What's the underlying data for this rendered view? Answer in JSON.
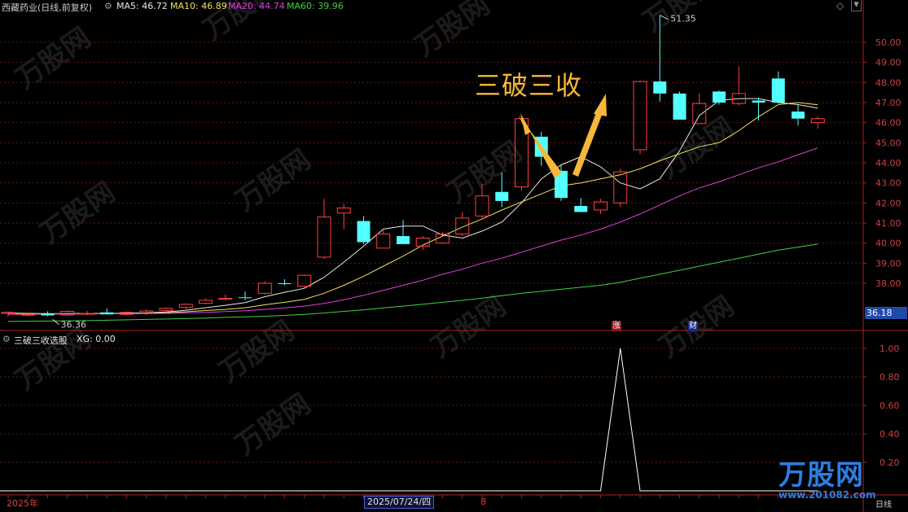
{
  "stock_title": "西藏药业(日线,前复权)",
  "indicators": [
    {
      "label": "MA5: 46.72",
      "color": "#e8e8e8"
    },
    {
      "label": "MA10: 46.89",
      "color": "#f0e060"
    },
    {
      "label": "MA20: 44.74",
      "color": "#e040e0"
    },
    {
      "label": "MA60: 39.96",
      "color": "#40d040"
    }
  ],
  "overlay_text": "三破三收",
  "price_tag": "36.18",
  "high_label": "51.35",
  "low_label": "36.36",
  "events": [
    "涨",
    "财"
  ],
  "sub_title": "三破三收选股",
  "sub_value": "XG: 0.00",
  "year_label": "2025年",
  "date_label": "2025/07/24/四",
  "month_label": "8",
  "period_label": "日线",
  "watermark_text": "万股网",
  "watermark_url": "www.201082.com",
  "chart_data": [
    {
      "type": "candlestick",
      "ylim": [
        36.0,
        51.0
      ],
      "y_ticks": [
        "50.00",
        "49.00",
        "48.00",
        "47.00",
        "46.00",
        "45.00",
        "44.00",
        "43.00",
        "42.00",
        "41.00",
        "40.00",
        "39.00",
        "38.00"
      ],
      "candles": [
        {
          "o": 36.5,
          "h": 36.6,
          "l": 36.35,
          "c": 36.55,
          "up": true
        },
        {
          "o": 36.45,
          "h": 36.55,
          "l": 36.36,
          "c": 36.45,
          "up": true
        },
        {
          "o": 36.48,
          "h": 36.6,
          "l": 36.36,
          "c": 36.4,
          "up": false
        },
        {
          "o": 36.42,
          "h": 36.65,
          "l": 36.38,
          "c": 36.6,
          "up": true
        },
        {
          "o": 36.5,
          "h": 36.62,
          "l": 36.42,
          "c": 36.5,
          "up": true
        },
        {
          "o": 36.55,
          "h": 36.75,
          "l": 36.45,
          "c": 36.45,
          "up": false
        },
        {
          "o": 36.45,
          "h": 36.6,
          "l": 36.4,
          "c": 36.55,
          "up": true
        },
        {
          "o": 36.5,
          "h": 36.7,
          "l": 36.42,
          "c": 36.62,
          "up": true
        },
        {
          "o": 36.65,
          "h": 36.8,
          "l": 36.55,
          "c": 36.75,
          "up": true
        },
        {
          "o": 36.8,
          "h": 37.0,
          "l": 36.7,
          "c": 36.95,
          "up": true
        },
        {
          "o": 37.0,
          "h": 37.25,
          "l": 36.95,
          "c": 37.15,
          "up": true
        },
        {
          "o": 37.25,
          "h": 37.45,
          "l": 37.15,
          "c": 37.2,
          "up": true
        },
        {
          "o": 37.3,
          "h": 37.6,
          "l": 37.15,
          "c": 37.3,
          "up": false
        },
        {
          "o": 37.5,
          "h": 38.1,
          "l": 37.45,
          "c": 38.0,
          "up": true
        },
        {
          "o": 38.0,
          "h": 38.2,
          "l": 37.9,
          "c": 38.0,
          "up": false
        },
        {
          "o": 37.85,
          "h": 38.45,
          "l": 37.75,
          "c": 38.4,
          "up": true
        },
        {
          "o": 39.3,
          "h": 42.2,
          "l": 39.2,
          "c": 41.3,
          "up": true
        },
        {
          "o": 41.5,
          "h": 41.95,
          "l": 40.7,
          "c": 41.75,
          "up": true
        },
        {
          "o": 41.1,
          "h": 41.35,
          "l": 39.95,
          "c": 40.05,
          "up": false
        },
        {
          "o": 39.75,
          "h": 40.65,
          "l": 39.75,
          "c": 40.45,
          "up": true
        },
        {
          "o": 40.35,
          "h": 41.15,
          "l": 39.95,
          "c": 39.95,
          "up": false
        },
        {
          "o": 39.85,
          "h": 40.35,
          "l": 39.65,
          "c": 40.25,
          "up": true
        },
        {
          "o": 40.0,
          "h": 40.55,
          "l": 39.95,
          "c": 40.45,
          "up": true
        },
        {
          "o": 40.45,
          "h": 41.55,
          "l": 40.35,
          "c": 41.25,
          "up": true
        },
        {
          "o": 41.35,
          "h": 42.95,
          "l": 41.25,
          "c": 42.35,
          "up": true
        },
        {
          "o": 42.55,
          "h": 43.55,
          "l": 41.8,
          "c": 42.1,
          "up": false
        },
        {
          "o": 42.8,
          "h": 46.25,
          "l": 42.6,
          "c": 46.2,
          "up": true
        },
        {
          "o": 45.3,
          "h": 45.55,
          "l": 43.85,
          "c": 44.3,
          "up": false
        },
        {
          "o": 43.6,
          "h": 43.9,
          "l": 42.1,
          "c": 42.25,
          "up": false
        },
        {
          "o": 41.85,
          "h": 42.25,
          "l": 41.55,
          "c": 41.55,
          "up": false
        },
        {
          "o": 41.65,
          "h": 42.2,
          "l": 41.45,
          "c": 42.05,
          "up": true
        },
        {
          "o": 42.0,
          "h": 43.7,
          "l": 41.8,
          "c": 43.55,
          "up": true
        },
        {
          "o": 44.65,
          "h": 48.1,
          "l": 44.45,
          "c": 48.05,
          "up": true
        },
        {
          "o": 48.05,
          "h": 51.35,
          "l": 47.05,
          "c": 47.45,
          "up": false
        },
        {
          "o": 47.45,
          "h": 47.55,
          "l": 46.15,
          "c": 46.15,
          "up": false
        },
        {
          "o": 45.95,
          "h": 47.45,
          "l": 45.95,
          "c": 46.95,
          "up": true
        },
        {
          "o": 47.0,
          "h": 47.6,
          "l": 46.9,
          "c": 47.55,
          "up": false
        },
        {
          "o": 46.95,
          "h": 48.8,
          "l": 46.85,
          "c": 47.45,
          "up": true
        },
        {
          "o": 47.0,
          "h": 47.25,
          "l": 46.1,
          "c": 47.1,
          "up": false
        },
        {
          "o": 48.2,
          "h": 48.55,
          "l": 46.95,
          "c": 47.0,
          "up": false
        },
        {
          "o": 46.55,
          "h": 46.9,
          "l": 45.85,
          "c": 46.2,
          "up": false
        },
        {
          "o": 46.0,
          "h": 46.3,
          "l": 45.7,
          "c": 46.2,
          "up": true
        }
      ],
      "ma": [
        {
          "name": "MA5",
          "color": "#e8e8e8",
          "values": [
            36.52,
            36.5,
            36.47,
            36.49,
            36.5,
            36.5,
            36.51,
            36.53,
            36.57,
            36.66,
            36.78,
            36.9,
            37.04,
            37.33,
            37.55,
            37.75,
            38.3,
            39.05,
            39.85,
            40.7,
            40.85,
            40.85,
            40.4,
            40.25,
            40.6,
            41.05,
            42.0,
            43.2,
            43.9,
            44.3,
            43.8,
            43.0,
            42.7,
            43.2,
            44.6,
            46.35,
            47.1,
            47.2,
            47.2,
            47.0,
            46.9,
            46.72
          ]
        },
        {
          "name": "MA10",
          "color": "#f0e060",
          "values": [
            36.5,
            36.5,
            36.49,
            36.49,
            36.5,
            36.5,
            36.5,
            36.51,
            36.53,
            36.58,
            36.64,
            36.7,
            36.78,
            36.93,
            37.05,
            37.2,
            37.5,
            37.9,
            38.35,
            38.85,
            39.35,
            39.9,
            40.35,
            40.8,
            41.2,
            41.65,
            42.05,
            42.45,
            42.85,
            43.0,
            43.2,
            43.4,
            43.7,
            44.1,
            44.45,
            44.8,
            45.0,
            45.6,
            46.3,
            46.9,
            47.0,
            46.89
          ]
        },
        {
          "name": "MA20",
          "color": "#e040e0",
          "values": [
            36.45,
            36.46,
            36.46,
            36.47,
            36.47,
            36.48,
            36.48,
            36.49,
            36.5,
            36.52,
            36.55,
            36.59,
            36.63,
            36.7,
            36.77,
            36.86,
            37.0,
            37.18,
            37.4,
            37.65,
            37.9,
            38.15,
            38.45,
            38.7,
            39.0,
            39.25,
            39.55,
            39.85,
            40.15,
            40.4,
            40.7,
            41.05,
            41.45,
            41.9,
            42.35,
            42.75,
            43.05,
            43.4,
            43.75,
            44.05,
            44.4,
            44.74
          ]
        },
        {
          "name": "MA60",
          "color": "#40d040",
          "values": [
            36.1,
            36.11,
            36.12,
            36.13,
            36.14,
            36.16,
            36.18,
            36.2,
            36.22,
            36.24,
            36.27,
            36.3,
            36.33,
            36.36,
            36.4,
            36.45,
            36.52,
            36.6,
            36.68,
            36.77,
            36.86,
            36.96,
            37.05,
            37.15,
            37.26,
            37.38,
            37.5,
            37.6,
            37.7,
            37.8,
            37.9,
            38.05,
            38.25,
            38.45,
            38.65,
            38.85,
            39.05,
            39.25,
            39.45,
            39.65,
            39.8,
            39.96
          ]
        }
      ]
    },
    {
      "type": "line",
      "name": "XG",
      "ylim": [
        0,
        1.1
      ],
      "y_ticks": [
        "1.00",
        "0.80",
        "0.60",
        "0.40",
        "0.20"
      ],
      "values": [
        0,
        0,
        0,
        0,
        0,
        0,
        0,
        0,
        0,
        0,
        0,
        0,
        0,
        0,
        0,
        0,
        0,
        0,
        0,
        0,
        0,
        0,
        0,
        0,
        0,
        0,
        0,
        0,
        0,
        0,
        0,
        1,
        0,
        0,
        0,
        0,
        0,
        0,
        0,
        0,
        0,
        0
      ]
    }
  ]
}
